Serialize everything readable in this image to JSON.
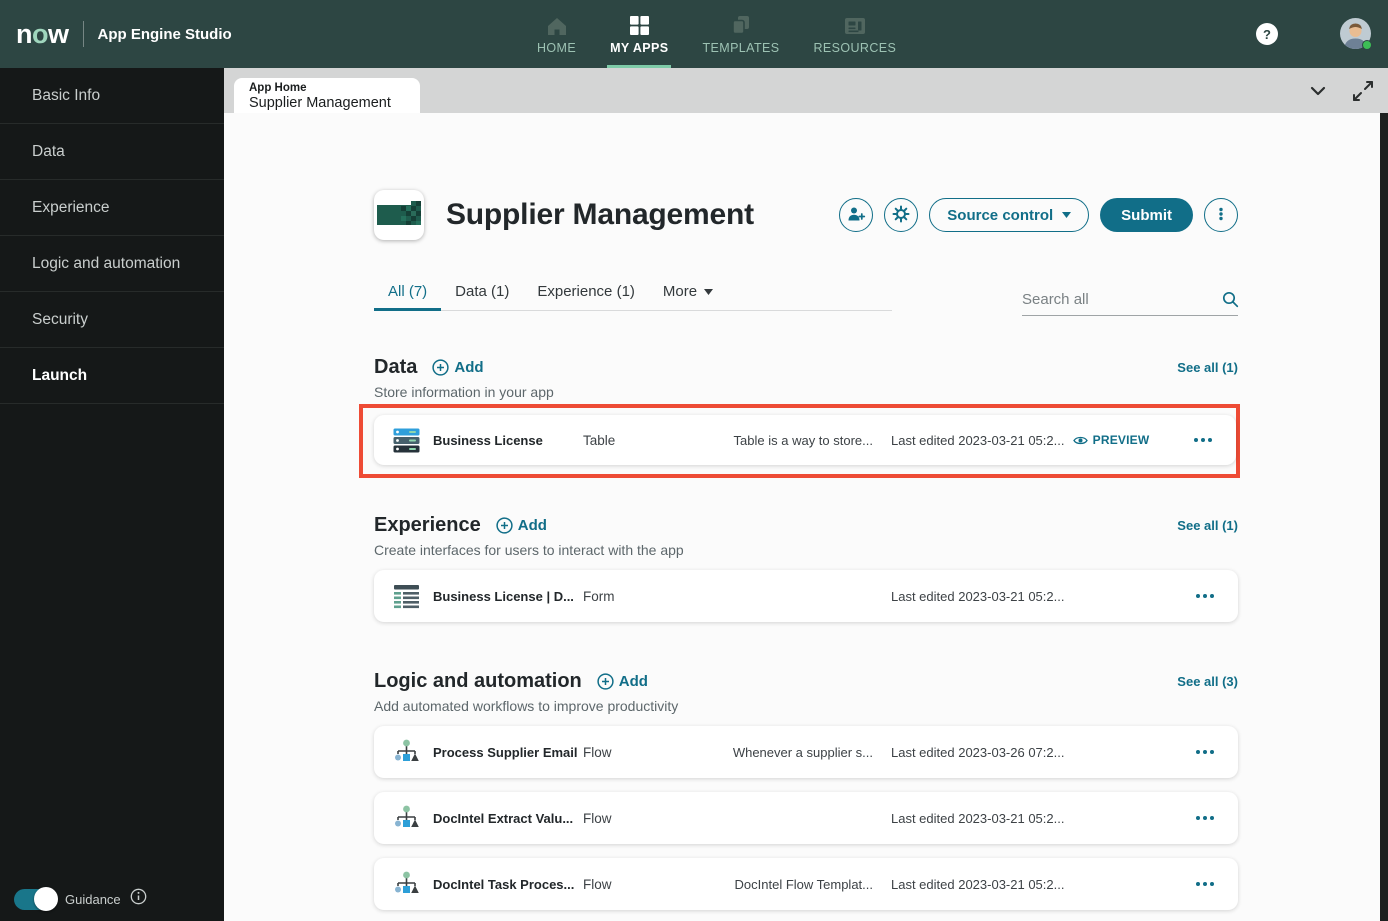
{
  "topnav": {
    "logo": "now",
    "product": "App Engine Studio",
    "items": [
      {
        "label": "HOME",
        "icon": "home-icon",
        "active": false
      },
      {
        "label": "MY APPS",
        "icon": "grid-icon",
        "active": true
      },
      {
        "label": "TEMPLATES",
        "icon": "templates-icon",
        "active": false
      },
      {
        "label": "RESOURCES",
        "icon": "resources-icon",
        "active": false
      }
    ],
    "help": "?"
  },
  "tabstrip": {
    "kicker": "App Home",
    "title": "Supplier Management"
  },
  "sidebar": {
    "items": [
      {
        "label": "Basic Info",
        "active": false
      },
      {
        "label": "Data",
        "active": false
      },
      {
        "label": "Experience",
        "active": false
      },
      {
        "label": "Logic and automation",
        "active": false
      },
      {
        "label": "Security",
        "active": false
      },
      {
        "label": "Launch",
        "active": true
      }
    ],
    "guidance_label": "Guidance"
  },
  "header": {
    "title": "Supplier Management",
    "source_control_label": "Source control",
    "submit_label": "Submit"
  },
  "filter_tabs": {
    "items": [
      "All (7)",
      "Data (1)",
      "Experience (1)"
    ],
    "more_label": "More"
  },
  "search": {
    "placeholder": "Search all"
  },
  "sections": [
    {
      "title": "Data",
      "add_label": "Add",
      "see_all": "See all (1)",
      "subtitle": "Store information in your app",
      "rows": [
        {
          "icon": "table-icon",
          "name": "Business License",
          "type": "Table",
          "description": "Table is a way to store...",
          "last_edited": "Last edited 2023-03-21 05:2...",
          "preview_label": "PREVIEW",
          "highlighted": true
        }
      ]
    },
    {
      "title": "Experience",
      "add_label": "Add",
      "see_all": "See all (1)",
      "subtitle": "Create interfaces for users to interact with the app",
      "rows": [
        {
          "icon": "form-icon",
          "name": "Business License | D...",
          "type": "Form",
          "description": "",
          "last_edited": "Last edited 2023-03-21 05:2..."
        }
      ]
    },
    {
      "title": "Logic and automation",
      "add_label": "Add",
      "see_all": "See all (3)",
      "subtitle": "Add automated workflows to improve productivity",
      "rows": [
        {
          "icon": "flow-icon",
          "name": "Process Supplier Email",
          "type": "Flow",
          "description": "Whenever a supplier s...",
          "last_edited": "Last edited 2023-03-26 07:2..."
        },
        {
          "icon": "flow-icon",
          "name": "DocIntel Extract Valu...",
          "type": "Flow",
          "description": "",
          "last_edited": "Last edited 2023-03-21 05:2..."
        },
        {
          "icon": "flow-icon",
          "name": "DocIntel Task Proces...",
          "type": "Flow",
          "description": "DocIntel Flow Templat...",
          "last_edited": "Last edited 2023-03-21 05:2..."
        }
      ]
    }
  ],
  "colors": {
    "accent_teal": "#116E88",
    "highlight_red": "#EE4B35",
    "topnav_bg": "#2D4643",
    "sidebar_bg": "#151818",
    "active_underline_green": "#7ECBA8",
    "tabstrip_bg": "#D4D5D5",
    "status_green": "#3DBE56"
  }
}
